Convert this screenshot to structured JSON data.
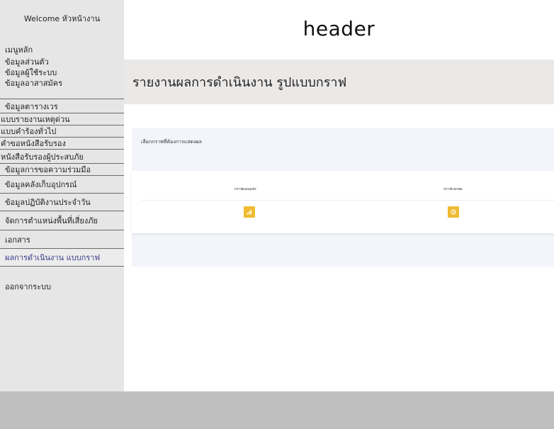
{
  "sidebar": {
    "welcome": "Welcome หัวหน้างาน",
    "top_items": [
      "เมนูหลัก",
      "ข้อมูลส่วนตัว",
      "ข้อมูลผู้ใช้ระบบ",
      "ข้อมูลอาสาสมัคร"
    ],
    "list_items": [
      "ข้อมูลตารางเวร",
      "แบบรายงานเหตุด่วน",
      "แบบคำร้องทั่วไป",
      "คำขอหนังสือรับรอง",
      "หนังสือรับรองผู้ประสบภัย",
      "ข้อมูลการขอความร่วมมือ",
      "ข้อมูลคลังเก็บอุปกรณ์",
      "ข้อมูลปฏิบัติงานประจำวัน",
      "จัดการตำแหน่งพื้นที่เสี่ยงภัย",
      "เอกสาร",
      "ผลการดำเนินงาน แบบกราฟ"
    ],
    "logout": "ออกจากระบบ"
  },
  "header": {
    "title": "header"
  },
  "page": {
    "title": "รายงานผลการดำเนินงาน รูปแบบกราฟ"
  },
  "panel": {
    "heading": "เลือกกราฟที่ต้องการแสดงผล",
    "options": [
      {
        "label": "กราฟแบบแท่ง",
        "icon": "bar-chart-icon"
      },
      {
        "label": "กราฟวงกลม",
        "icon": "pie-chart-icon"
      }
    ]
  },
  "colors": {
    "sidebar_bg": "#e6e6e6",
    "title_bar_bg": "#ebe9e8",
    "panel_bg": "#f4f5fa",
    "accent_button": "#f0bb32",
    "footer_bg": "#bfbfbf",
    "active_item": "#3a3a8a"
  }
}
